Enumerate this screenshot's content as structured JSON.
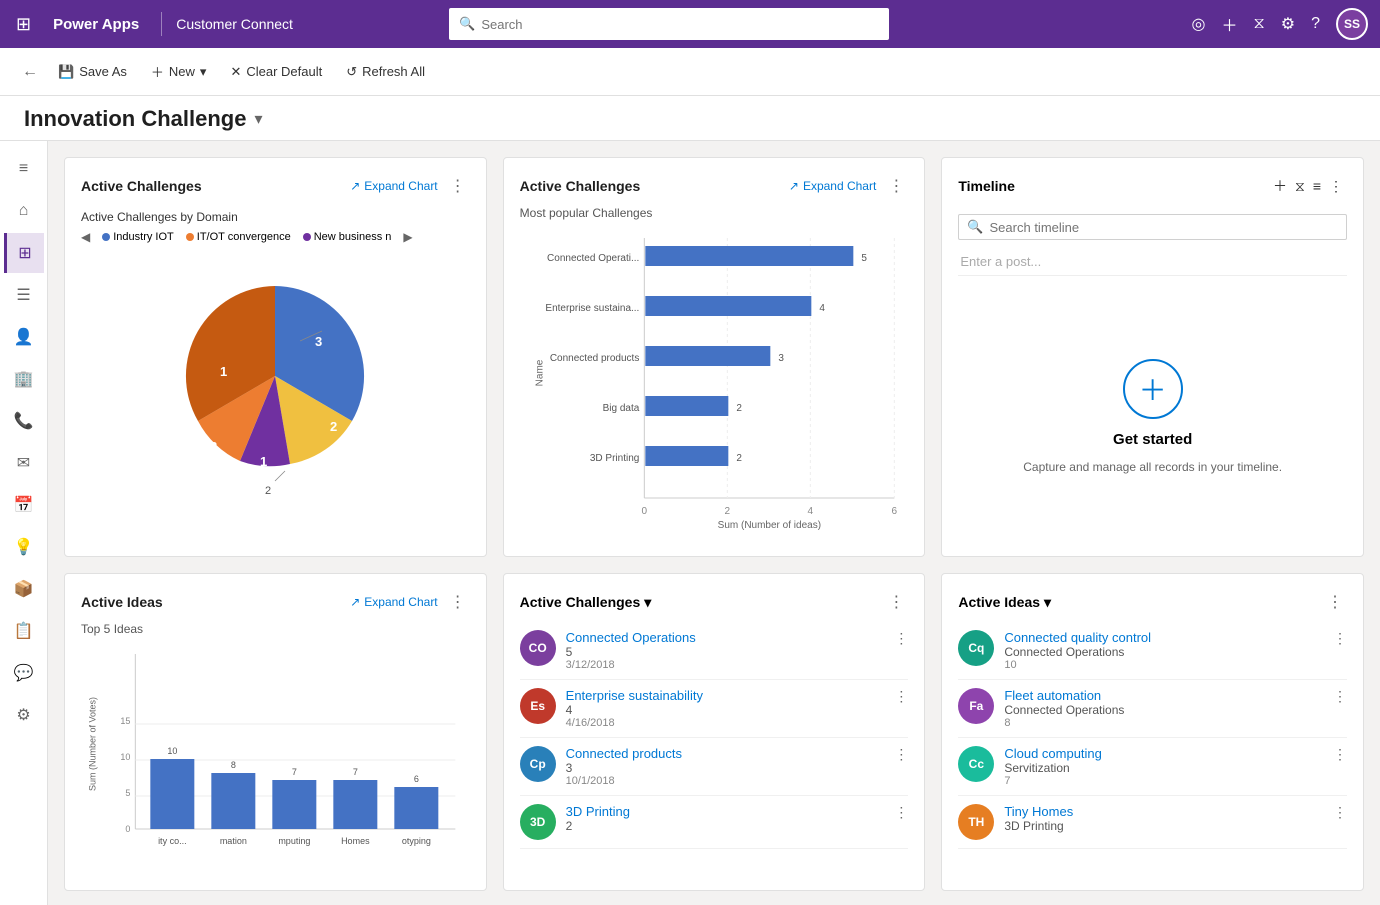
{
  "topbar": {
    "logo": "Power Apps",
    "appname": "Customer Connect",
    "search_placeholder": "Search",
    "avatar_initials": "SS"
  },
  "toolbar": {
    "save_as": "Save As",
    "new": "New",
    "clear_default": "Clear Default",
    "refresh_all": "Refresh All"
  },
  "page": {
    "title": "Innovation Challenge"
  },
  "chart1": {
    "title": "Active Challenges",
    "expand": "Expand Chart",
    "subtitle": "Active Challenges by Domain",
    "legend": [
      {
        "label": "Industry IOT",
        "color": "#4472c4"
      },
      {
        "label": "IT/OT convergence",
        "color": "#ed7d31"
      },
      {
        "label": "New business n",
        "color": "#7030a0"
      }
    ],
    "segments": [
      {
        "value": 3,
        "label": "3",
        "color": "#4472c4",
        "start": 0,
        "angle": 120
      },
      {
        "value": 2,
        "label": "2",
        "color": "#f0c040",
        "start": 120,
        "angle": 80
      },
      {
        "value": 1,
        "label": "1",
        "color": "#7030a0",
        "start": 200,
        "angle": 40
      },
      {
        "value": 2,
        "label": "2",
        "color": "#ed7d31",
        "start": 240,
        "angle": 80
      },
      {
        "value": 1,
        "label": "1",
        "color": "#ed7d31",
        "start": 320,
        "angle": 40
      }
    ]
  },
  "chart2": {
    "title": "Active Challenges",
    "expand": "Expand Chart",
    "subtitle": "Most popular Challenges",
    "x_label": "Sum (Number of ideas)",
    "y_label": "Name",
    "bars": [
      {
        "label": "Connected Operati...",
        "value": 5,
        "max": 6
      },
      {
        "label": "Enterprise sustaina...",
        "value": 4,
        "max": 6
      },
      {
        "label": "Connected products",
        "value": 3,
        "max": 6
      },
      {
        "label": "Big data",
        "value": 2,
        "max": 6
      },
      {
        "label": "3D Printing",
        "value": 2,
        "max": 6
      }
    ],
    "x_ticks": [
      "0",
      "2",
      "4",
      "6"
    ]
  },
  "timeline": {
    "title": "Timeline",
    "search_placeholder": "Search timeline",
    "post_placeholder": "Enter a post...",
    "empty_title": "Get started",
    "empty_desc": "Capture and manage all records in your timeline."
  },
  "chart3": {
    "title": "Active Ideas",
    "expand": "Expand Chart",
    "subtitle": "Top 5 Ideas",
    "y_label": "Sum (Number of Votes)",
    "bars": [
      {
        "label": "ity co...",
        "value": 10
      },
      {
        "label": "mation",
        "value": 8
      },
      {
        "label": "mputing",
        "value": 7
      },
      {
        "label": "Homes",
        "value": 7
      },
      {
        "label": "otyping",
        "value": 6
      }
    ],
    "y_max": 15
  },
  "list1": {
    "title": "Active Challenges",
    "items": [
      {
        "initials": "CO",
        "color": "#7b3f9e",
        "name": "Connected Operations",
        "sub": "5",
        "sub2": "3/12/2018"
      },
      {
        "initials": "Es",
        "color": "#c0392b",
        "name": "Enterprise sustainability",
        "sub": "4",
        "sub2": "4/16/2018"
      },
      {
        "initials": "Cp",
        "color": "#2980b9",
        "name": "Connected products",
        "sub": "3",
        "sub2": "10/1/2018"
      },
      {
        "initials": "3D",
        "color": "#27ae60",
        "name": "3D Printing",
        "sub": "2",
        "sub2": ""
      }
    ]
  },
  "list2": {
    "title": "Active Ideas",
    "items": [
      {
        "initials": "Cq",
        "color": "#16a085",
        "name": "Connected quality control",
        "sub": "Connected Operations",
        "sub2": "10"
      },
      {
        "initials": "Fa",
        "color": "#8e44ad",
        "name": "Fleet automation",
        "sub": "Connected Operations",
        "sub2": "8"
      },
      {
        "initials": "Cc",
        "color": "#1abc9c",
        "name": "Cloud computing",
        "sub": "Servitization",
        "sub2": "7"
      },
      {
        "initials": "TH",
        "color": "#e67e22",
        "name": "Tiny Homes",
        "sub": "3D Printing",
        "sub2": ""
      }
    ]
  },
  "sidebar": {
    "items": [
      {
        "icon": "≡",
        "name": "menu"
      },
      {
        "icon": "⌂",
        "name": "home"
      },
      {
        "icon": "⊞",
        "name": "dashboard",
        "active": true
      },
      {
        "icon": "☰",
        "name": "list"
      },
      {
        "icon": "👤",
        "name": "contact"
      },
      {
        "icon": "🏢",
        "name": "account"
      },
      {
        "icon": "☎",
        "name": "phone"
      },
      {
        "icon": "✉",
        "name": "email"
      },
      {
        "icon": "📅",
        "name": "calendar"
      },
      {
        "icon": "💡",
        "name": "ideas"
      },
      {
        "icon": "📦",
        "name": "products"
      },
      {
        "icon": "📋",
        "name": "tasks"
      },
      {
        "icon": "💬",
        "name": "chat"
      },
      {
        "icon": "⚙",
        "name": "settings"
      }
    ]
  }
}
